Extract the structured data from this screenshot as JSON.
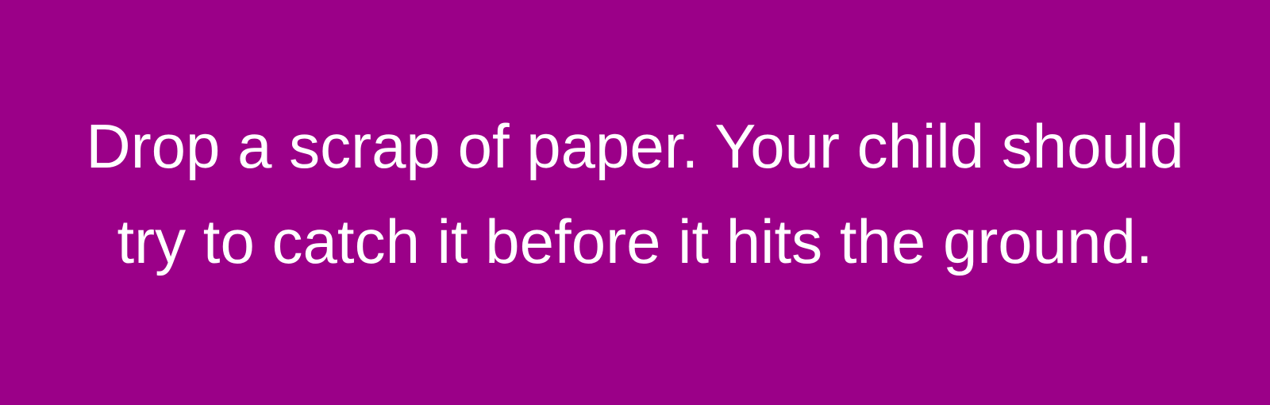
{
  "card": {
    "background_color": "#9b0088",
    "text_color": "#ffffff",
    "lines": [
      "Drop a scrap of paper. Your child should",
      "try to catch it before it hits the ground."
    ]
  }
}
